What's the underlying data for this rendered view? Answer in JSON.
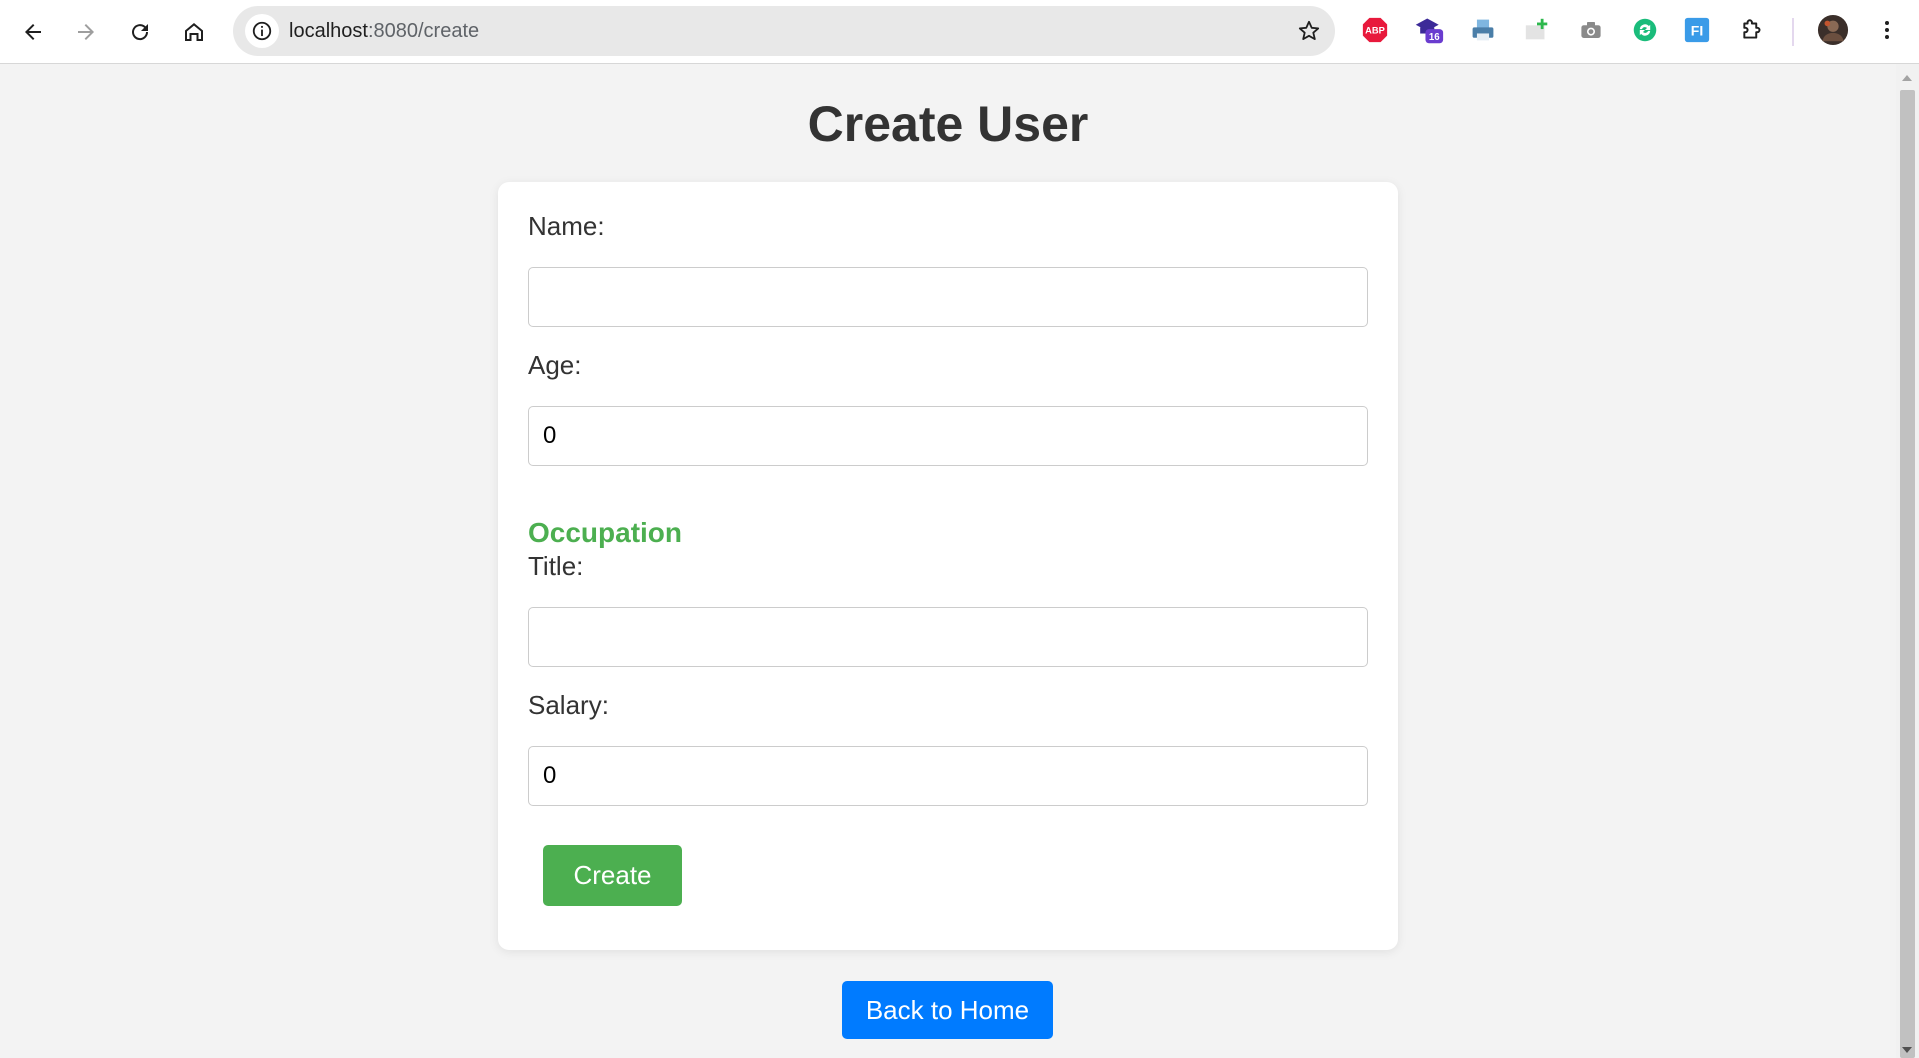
{
  "browser": {
    "url_host": "localhost",
    "url_path": ":8080/create",
    "extensions": [
      {
        "name": "adblock-plus-icon",
        "label": "ABP"
      },
      {
        "name": "graduation-cap-extension-icon",
        "badge": "16"
      },
      {
        "name": "printer-extension-icon"
      },
      {
        "name": "add-tab-extension-icon"
      },
      {
        "name": "camera-extension-icon"
      },
      {
        "name": "sync-extension-icon"
      },
      {
        "name": "fi-extension-icon",
        "label": "FI"
      }
    ]
  },
  "page": {
    "title": "Create User"
  },
  "form": {
    "name_label": "Name:",
    "name_value": "",
    "age_label": "Age:",
    "age_value": "0",
    "occupation_heading": "Occupation",
    "title_label": "Title:",
    "title_value": "",
    "salary_label": "Salary:",
    "salary_value": "0",
    "submit_label": "Create"
  },
  "back_button": {
    "label": "Back to Home"
  },
  "colors": {
    "accent_green": "#4caf50",
    "accent_blue": "#007bff",
    "background": "#f3f3f3"
  }
}
